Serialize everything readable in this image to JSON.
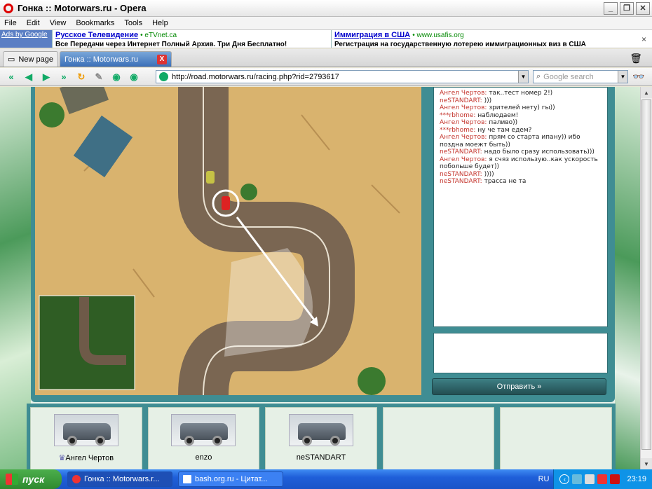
{
  "window": {
    "title": "Гонка :: Motorwars.ru - Opera"
  },
  "menu": [
    "File",
    "Edit",
    "View",
    "Bookmarks",
    "Tools",
    "Help"
  ],
  "ads": {
    "ads_by": "Ads by Google",
    "ad1": {
      "headline": "Русское Телевидение",
      "site": "eTVnet.ca",
      "desc": "Все Передачи через Интернет Полный Архив. Три Дня Бесплатно!"
    },
    "ad2": {
      "headline": "Иммиграция в США",
      "site": "www.usafis.org",
      "desc": "Регистрация на государственную лотерею иммиграционных виз в США"
    },
    "close": "×"
  },
  "tabs": [
    {
      "label": "New page"
    },
    {
      "label": "Гонка :: Motorwars.ru",
      "close": "X"
    }
  ],
  "nav": {
    "url": "http://road.motorwars.ru/racing.php?rid=2793617",
    "search_placeholder": "Google search"
  },
  "chat": {
    "messages": [
      {
        "name": "Ангел Чертов:",
        "text": "так..тест номер 2!)"
      },
      {
        "name": "neSTANDART:",
        "text": ")))"
      },
      {
        "name": "Ангел Чертов:",
        "text": "зрителей нету) гы))"
      },
      {
        "name": "***rbhome:",
        "text": "наблюдаем!"
      },
      {
        "name": "Ангел Чертов:",
        "text": "паливо))"
      },
      {
        "name": "***rbhome:",
        "text": "ну че там едем?"
      },
      {
        "name": "Ангел Чертов:",
        "text": "прям со старта ипану)) ибо поздна моежт быть))"
      },
      {
        "name": "neSTANDART:",
        "text": "надо было сразу использовать)))"
      },
      {
        "name": "Ангел Чертов:",
        "text": "я счяз использую..как ускорость побольше будет))"
      },
      {
        "name": "neSTANDART:",
        "text": "))))"
      },
      {
        "name": "neSTANDART:",
        "text": "трасса не та"
      }
    ],
    "send_label": "Отправить »"
  },
  "players": [
    {
      "name": "Ангел Чертов"
    },
    {
      "name": "enzo"
    },
    {
      "name": "neSTANDART"
    },
    {
      "name": ""
    },
    {
      "name": ""
    }
  ],
  "taskbar": {
    "start": "пуск",
    "tasks": [
      {
        "label": "Гонка :: Motorwars.r..."
      },
      {
        "label": "bash.org.ru - Цитат..."
      }
    ],
    "lang": "RU",
    "clock": "23:19"
  },
  "colors": {
    "accent": "#3f8d93",
    "chat_name": "#c4342c",
    "road": "#6e5a48",
    "sand": "#d9b36e"
  }
}
